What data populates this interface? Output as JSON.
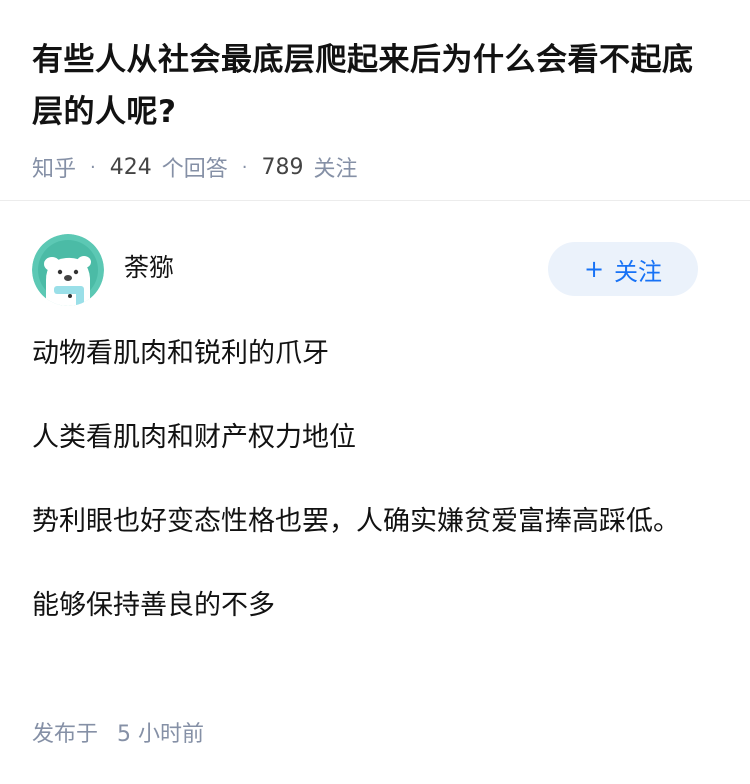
{
  "question": {
    "title": "有些人从社会最底层爬起来后为什么会看不起底层的人呢?",
    "source": "知乎",
    "answers_count": "424",
    "answers_label": "个回答",
    "followers_count": "789",
    "followers_label": "关注"
  },
  "answer": {
    "author_name": "荼猕",
    "follow_label": "关注",
    "follow_plus": "+",
    "paragraphs": [
      "动物看肌肉和锐利的爪牙",
      "人类看肌肉和财产权力地位",
      "势利眼也好变态性格也罢，人确实嫌贫爱富捧高踩低。",
      "能够保持善良的不多"
    ],
    "published_label": "发布于",
    "published_time": "5 小时前"
  },
  "colors": {
    "accent": "#1772f6",
    "follow_bg": "#ebf2fb",
    "meta_gray": "#8590a6",
    "avatar_bg": "#5cc8b4"
  },
  "icons": {
    "avatar": "cartoon-character-avatar"
  }
}
